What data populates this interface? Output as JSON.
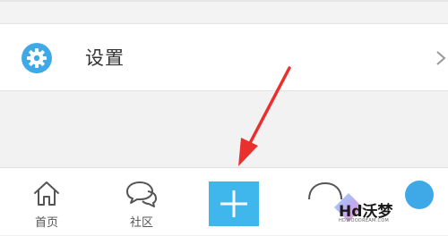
{
  "settings": {
    "label": "设置",
    "icon": "gear-icon"
  },
  "tabbar": {
    "items": [
      {
        "label": "首页",
        "icon": "home-icon"
      },
      {
        "label": "社区",
        "icon": "chat-bubbles-icon"
      },
      {
        "label": "",
        "icon": "plus-icon"
      },
      {
        "label": "",
        "icon": "message-icon"
      },
      {
        "label": "",
        "icon": "avatar-icon"
      }
    ]
  },
  "watermark": {
    "text": "Hd沃梦",
    "sub": "HDWOODREAM.COM"
  },
  "colors": {
    "accent": "#3fb7ec",
    "arrow": "#e8302f"
  }
}
